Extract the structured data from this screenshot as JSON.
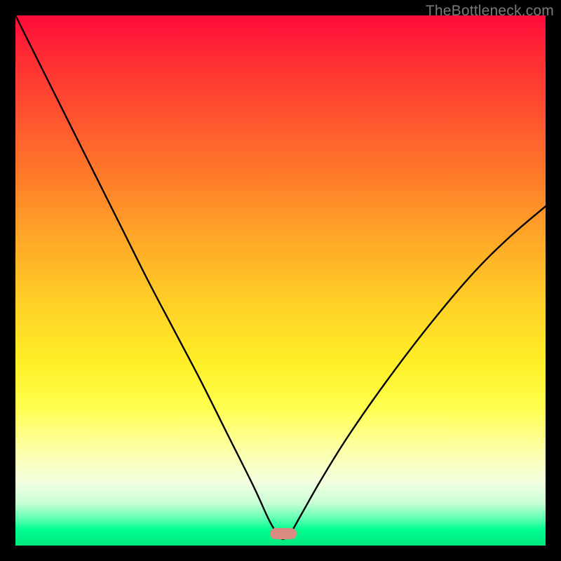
{
  "watermark": "TheBottleneck.com",
  "marker": {
    "color": "#d98b82",
    "x_frac": 0.505,
    "y_frac": 0.978
  },
  "chart_data": {
    "type": "line",
    "title": "",
    "xlabel": "",
    "ylabel": "",
    "xlim": [
      0,
      100
    ],
    "ylim": [
      0,
      100
    ],
    "x": [
      0,
      5,
      10,
      15,
      20,
      25,
      30,
      35,
      40,
      45,
      48,
      50,
      51,
      52,
      54,
      58,
      63,
      70,
      78,
      86,
      93,
      100
    ],
    "values": [
      100,
      90,
      80,
      70,
      60,
      50,
      40.5,
      31,
      21,
      11,
      4.5,
      1.5,
      1.5,
      2.5,
      6,
      13,
      21,
      31,
      41.5,
      51,
      58,
      64
    ],
    "annotations": [
      {
        "label": "min-marker",
        "x": 50.5,
        "y": 2.2
      }
    ]
  }
}
